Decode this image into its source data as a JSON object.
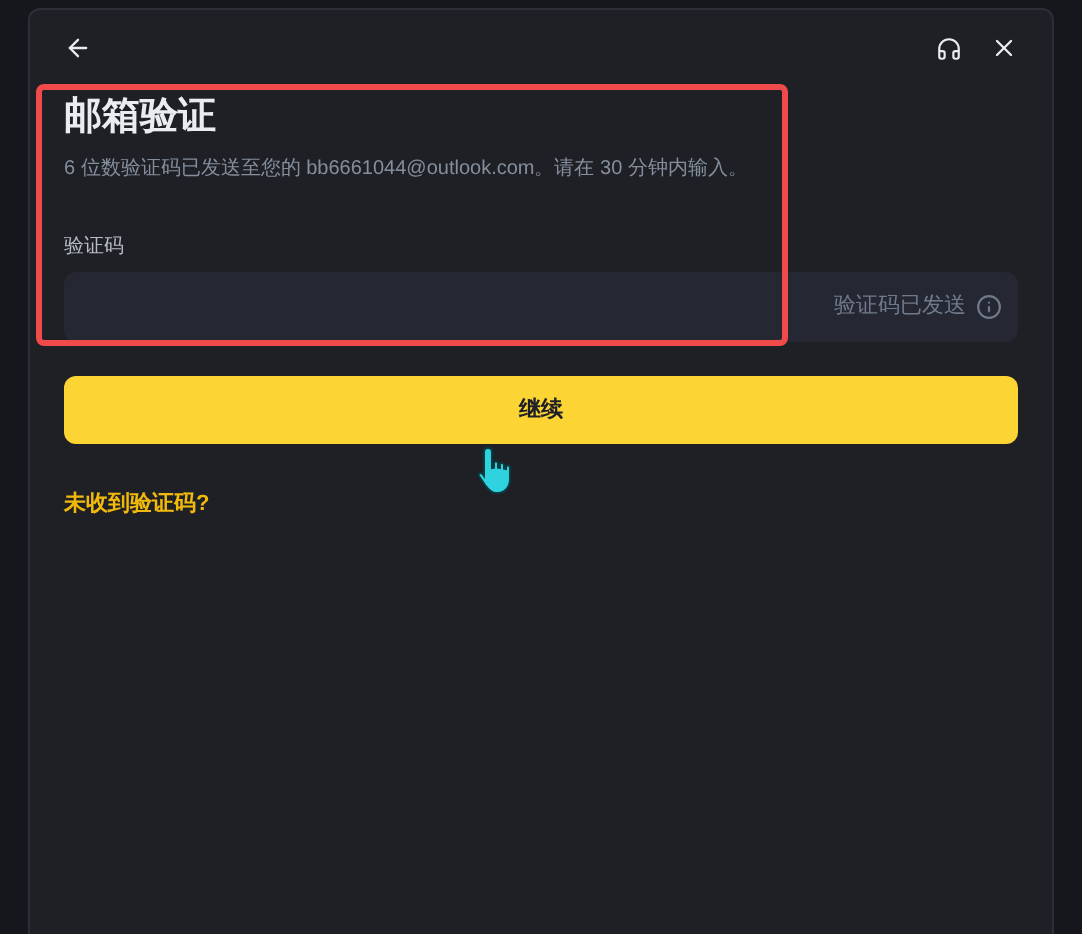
{
  "title": "邮箱验证",
  "description": "6 位数验证码已发送至您的 bb6661044@outlook.com。请在 30 分钟内输入。",
  "code_field": {
    "label": "验证码",
    "status": "验证码已发送"
  },
  "continue_button": "继续",
  "resend_link": "未收到验证码?"
}
